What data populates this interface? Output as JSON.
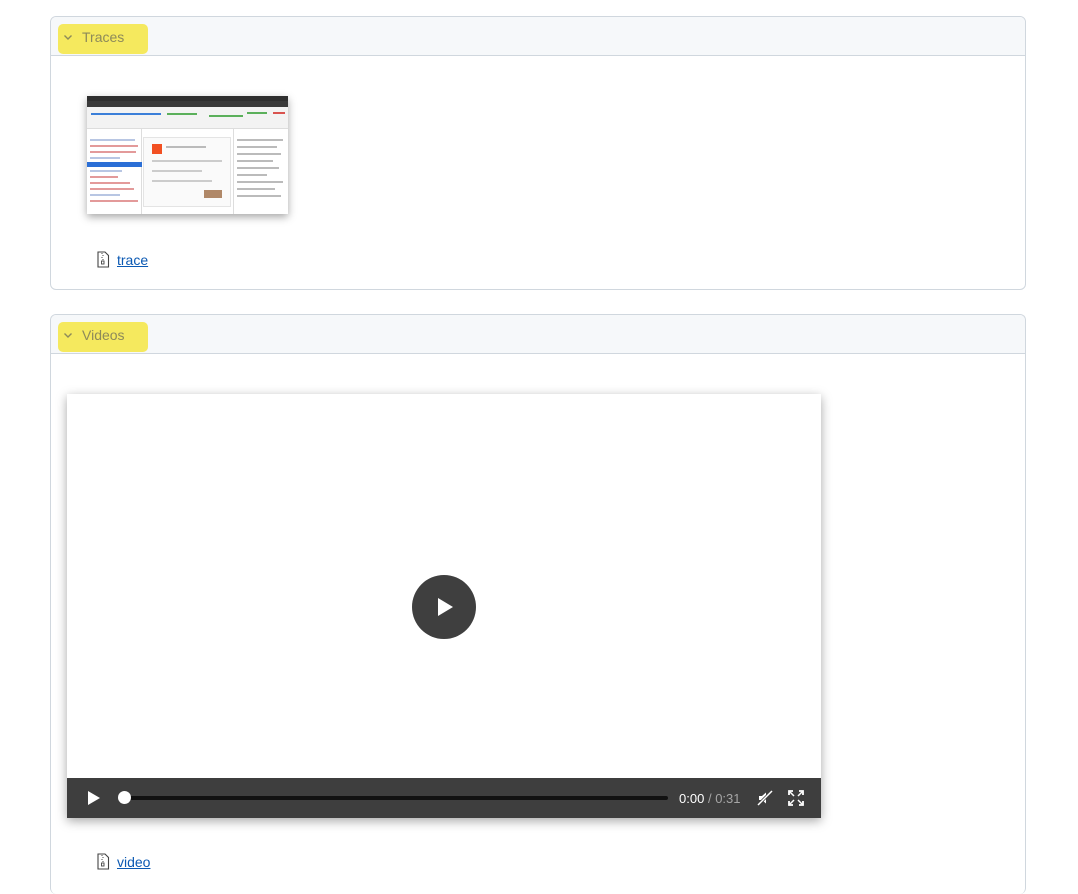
{
  "traces": {
    "title": "Traces",
    "link_label": "trace",
    "chevron_icon": "chevron-down-icon",
    "file_icon": "zip-file-icon"
  },
  "videos": {
    "title": "Videos",
    "link_label": "video",
    "chevron_icon": "chevron-down-icon",
    "file_icon": "zip-file-icon",
    "player": {
      "current_time": "0:00",
      "separator": "/",
      "duration": "0:31",
      "progress": 0,
      "muted": true
    }
  },
  "colors": {
    "highlight": "#f5e642",
    "link": "#0b59b3",
    "header_bg": "#f6f8fa",
    "border": "#d0d7de",
    "controls_bg": "#3e3e3e"
  }
}
